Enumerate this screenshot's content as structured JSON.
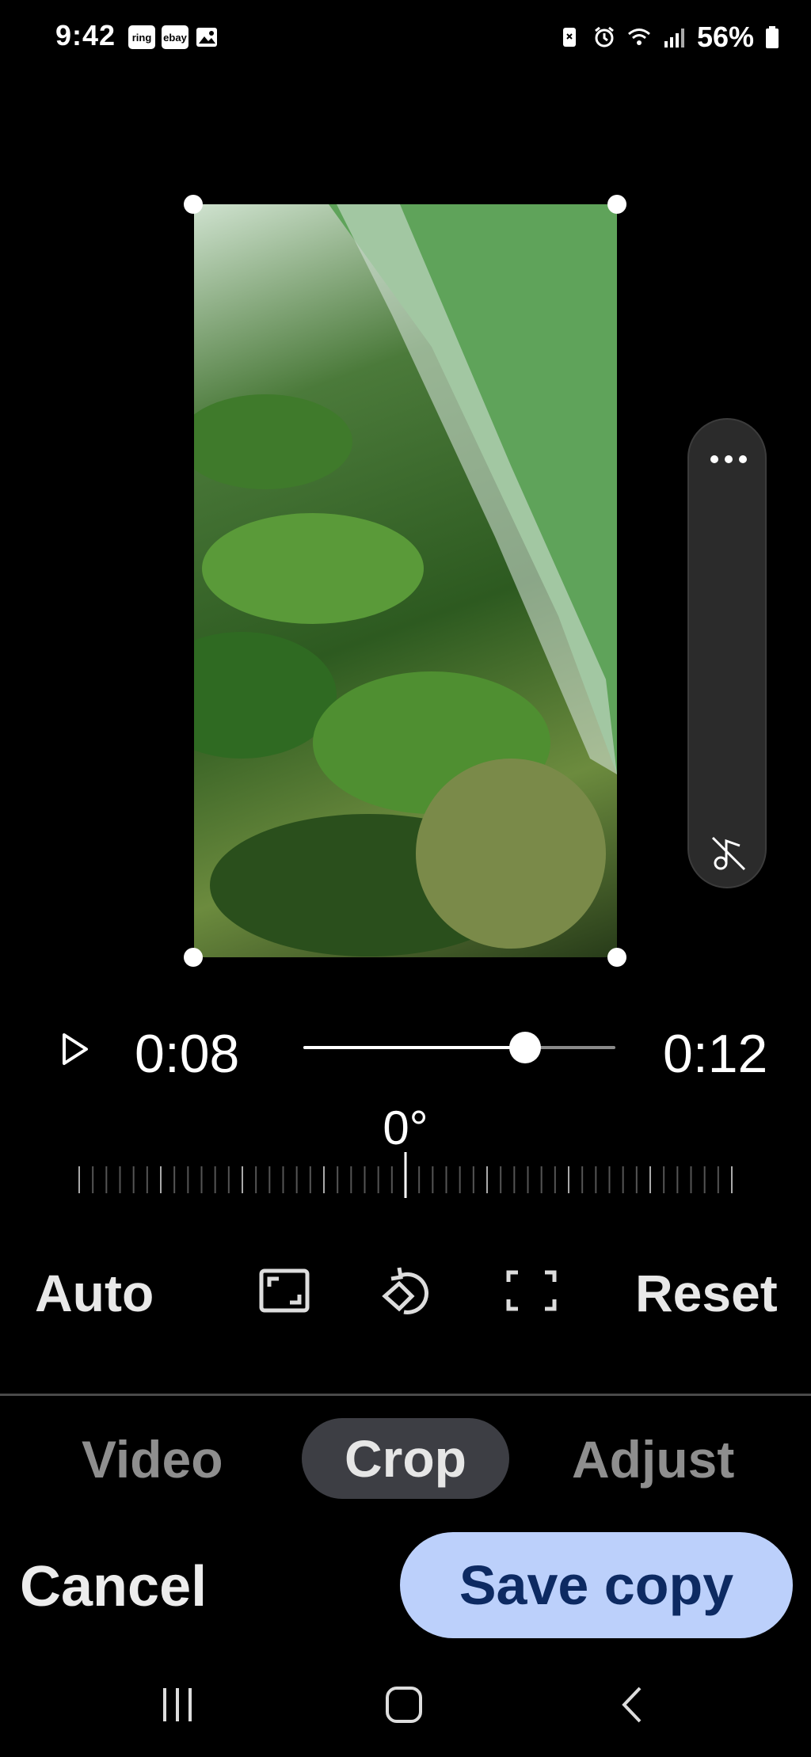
{
  "status_bar": {
    "time": "9:42",
    "notifications": [
      "ring",
      "ebay",
      "gallery"
    ],
    "battery_text": "56%"
  },
  "player": {
    "current_time": "0:08",
    "total_time": "0:12",
    "progress": 0.71
  },
  "rotation": {
    "angle": "0°"
  },
  "toolbar": {
    "auto_label": "Auto",
    "reset_label": "Reset",
    "icons": [
      "aspect-ratio-icon",
      "rotate-icon",
      "free-crop-icon"
    ]
  },
  "tabs": [
    {
      "label": "Video",
      "active": false
    },
    {
      "label": "Crop",
      "active": true
    },
    {
      "label": "Adjust",
      "active": false
    }
  ],
  "actions": {
    "cancel_label": "Cancel",
    "save_label": "Save copy"
  },
  "colors": {
    "save_button_bg": "#bcd0fb",
    "save_button_text": "#0d2a62",
    "active_tab_bg": "#3d3e44"
  }
}
